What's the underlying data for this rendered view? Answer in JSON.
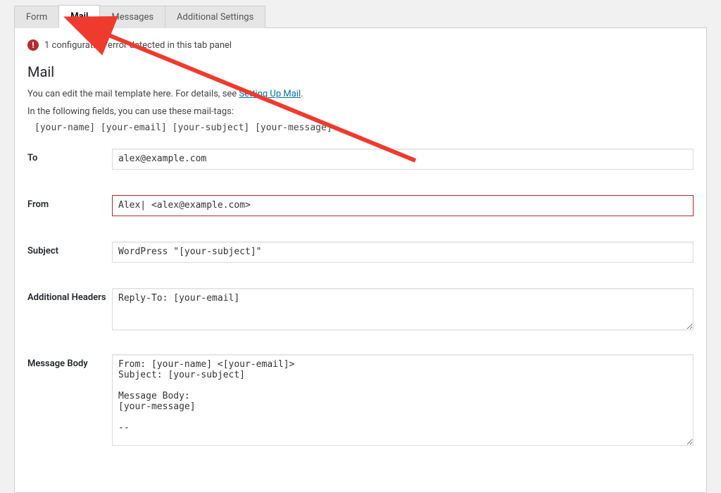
{
  "tabs": {
    "form": "Form",
    "mail": "Mail",
    "messages": "Messages",
    "additional_settings": "Additional Settings"
  },
  "notice": {
    "text": "1 configuration error detected in this tab panel",
    "icon_glyph": "!"
  },
  "section": {
    "title": "Mail",
    "intro_prefix": "You can edit the mail template here. For details, see ",
    "intro_link": "Setting Up Mail",
    "intro_suffix": ".",
    "intro_line2": "In the following fields, you can use these mail-tags:",
    "mailtags": "[your-name] [your-email] [your-subject] [your-message]"
  },
  "fields": {
    "to": {
      "label": "To",
      "value": "alex@example.com"
    },
    "from": {
      "label": "From",
      "value": "Alex| <alex@example.com>"
    },
    "subject": {
      "label": "Subject",
      "value": "WordPress \"[your-subject]\""
    },
    "additional_headers": {
      "label": "Additional Headers",
      "value": "Reply-To: [your-email]"
    },
    "message_body": {
      "label": "Message Body",
      "value": "From: [your-name] <[your-email]>\nSubject: [your-subject]\n\nMessage Body:\n[your-message]\n\n--"
    }
  }
}
